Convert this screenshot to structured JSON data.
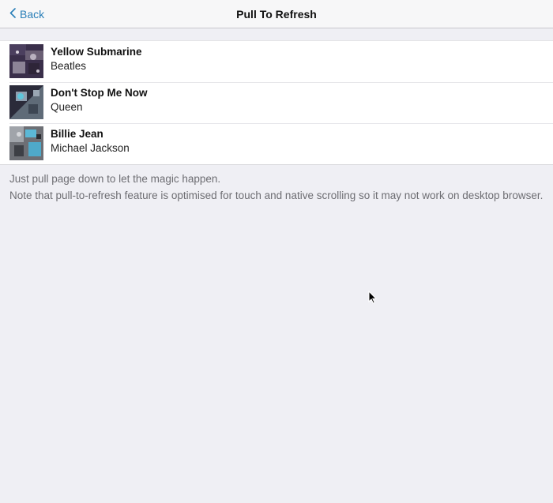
{
  "navbar": {
    "back_label": "Back",
    "title": "Pull To Refresh",
    "back_icon": "chevron-left-icon",
    "accent_color": "#2a7fb8"
  },
  "songs": [
    {
      "title": "Yellow Submarine",
      "artist": "Beatles",
      "thumb_icon": "album-art"
    },
    {
      "title": "Don't Stop Me Now",
      "artist": "Queen",
      "thumb_icon": "album-art"
    },
    {
      "title": "Billie Jean",
      "artist": "Michael Jackson",
      "thumb_icon": "album-art"
    }
  ],
  "notes": {
    "line1": "Just pull page down to let the magic happen.",
    "line2": "Note that pull-to-refresh feature is optimised for touch and native scrolling so it may not work on desktop browser."
  },
  "colors": {
    "background": "#efeff4",
    "navbar": "#f7f7f8",
    "list": "#ffffff"
  }
}
